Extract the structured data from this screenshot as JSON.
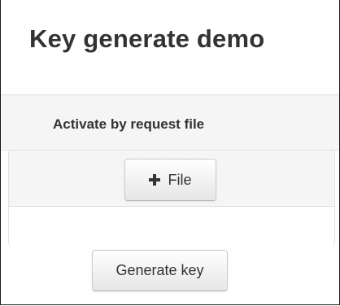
{
  "header": {
    "title": "Key generate demo"
  },
  "section": {
    "label": "Activate by request file"
  },
  "upload": {
    "file_button_label": "File",
    "file_button_icon": "plus-icon"
  },
  "actions": {
    "generate_label": "Generate key"
  },
  "colors": {
    "panel_background": "#f5f5f5",
    "text": "#333333",
    "border": "#cccccc"
  }
}
